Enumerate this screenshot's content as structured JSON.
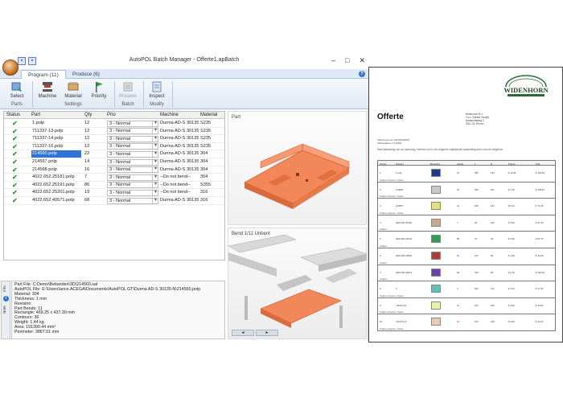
{
  "window": {
    "title": "AutoPOL Batch Manager - Offerte1.apBatch",
    "controls": [
      "–",
      "□",
      "✕"
    ]
  },
  "tabs": [
    {
      "label": "Program (11)",
      "active": true
    },
    {
      "label": "Produce (6)",
      "active": false
    }
  ],
  "ribbon": {
    "buttons": {
      "select": "Select",
      "machine": "Machine",
      "material": "Material",
      "priority": "Priority",
      "process": "Process",
      "inspect": "Inspect"
    },
    "groups": {
      "parts": "Parts",
      "settings": "Settings",
      "batch": "Batch",
      "modify": "Modify"
    }
  },
  "grid": {
    "columns": {
      "status": "Status",
      "part": "Part",
      "qty": "Qty",
      "prio": "Prio",
      "machine": "Machine",
      "material": "Material"
    },
    "rows": [
      {
        "part": "1.polp",
        "qty": "12",
        "prio": "3 - Normal",
        "machine": "Durma AD-S 30135...",
        "material": "S235"
      },
      {
        "part": "711337-13.polp",
        "qty": "12",
        "prio": "3 - Normal",
        "machine": "Durma AD-S 30135...",
        "material": "S235"
      },
      {
        "part": "711337-14.polp",
        "qty": "12",
        "prio": "3 - Normal",
        "machine": "Durma AD-S 30135...",
        "material": "S235"
      },
      {
        "part": "711337-16.polp",
        "qty": "12",
        "prio": "3 - Normal",
        "machine": "Durma AD-S 30135...",
        "material": "S235"
      },
      {
        "part": "214560.polp",
        "qty": "22",
        "prio": "3 - Normal",
        "machine": "Durma AD-S 30135...",
        "material": "304",
        "selected": true
      },
      {
        "part": "214567.polp",
        "qty": "14",
        "prio": "3 - Normal",
        "machine": "Durma AD-S 30135...",
        "material": "304"
      },
      {
        "part": "214568.polp",
        "qty": "16",
        "prio": "3 - Normal",
        "machine": "Durma AD-S 30135...",
        "material": "304"
      },
      {
        "part": "4022.652.25181.polp",
        "qty": "7",
        "prio": "3 - Normal",
        "machine": "--Do not bend--",
        "material": "304"
      },
      {
        "part": "4022.652.25191.polp",
        "qty": "86",
        "prio": "3 - Normal",
        "machine": "--Do not bend--",
        "material": "S355"
      },
      {
        "part": "4022.652.25201.polp",
        "qty": "19",
        "prio": "3 - Normal",
        "machine": "--Do not bend--",
        "material": "316"
      },
      {
        "part": "4022.652.40571.polp",
        "qty": "68",
        "prio": "3 - Normal",
        "machine": "Durma AD-S 30135...",
        "material": "316"
      }
    ]
  },
  "info": {
    "lines": [
      "Part File: C:Demo\\Beitanden\\3D\\214560.sat",
      "AutoPOL File: E:\\Users\\ance.ACEGA\\Documents\\AutoPOL GT\\Durma AD-S 30135-N\\214560.polp",
      "Material: 304",
      "Thickness: 1 mm",
      "Revision:",
      "Part Bends: 11",
      "Rectangle: 469.25 x 437.39 mm",
      "Contours: 36",
      "Weight: 1.44 kg",
      "Area: 191390.44 mm²",
      "Perimeter: 3867.01 mm"
    ]
  },
  "sidetabs": [
    "Info",
    "Note"
  ],
  "views": {
    "part_label": "Part",
    "bend_label": "Bend 1/11 Unbent",
    "nav": [
      "◄",
      "►"
    ]
  },
  "document": {
    "logo_text": "WIDENHORN",
    "title": "Offerte",
    "address": [
      "Widenhorn B.V.",
      "T.a.v. Gerard Hooijer",
      "Ambachtsweg 3",
      "3161 GL Rhoon"
    ],
    "meta": [
      "Offertenummer     OFF20230510",
      "Offertedatum      7-6-2023"
    ],
    "intro": "Naar aanleiding van uw aanvraag, hiermee kunt u de volgende vrijblijvende aanbieding doen van het volgende:",
    "columns": [
      "Positie",
      "Product",
      "Afbeelding",
      "Aantal",
      "L",
      "B",
      "Prijs/st.",
      "Prijs"
    ],
    "rows": [
      {
        "pos": "1",
        "product": "1.polp",
        "qty": "12",
        "l": "380",
        "b": "234",
        "unit": "€ 12,80",
        "total": "€ 153,60",
        "sub": "Snijden+Kanten / Zetten",
        "color": "#1f3c8c"
      },
      {
        "pos": "2",
        "product": "214560",
        "qty": "22",
        "l": "469",
        "b": "437",
        "unit": "€ 7,20",
        "total": "€ 158,40",
        "sub": "Snijden+Kanten / Zetten",
        "color": "#c9c9c9"
      },
      {
        "pos": "3",
        "product": "214567",
        "qty": "14",
        "l": "180",
        "b": "120",
        "unit": "€ 5,10",
        "total": "€ 71,40",
        "sub": "Snijden+Kanten / Zetten",
        "color": "#e6e07a"
      },
      {
        "pos": "4",
        "product": "4022.652.25181",
        "qty": "7",
        "l": "95",
        "b": "215",
        "unit": "€ 3,90",
        "total": "€ 27,30",
        "sub": "Snijden",
        "color": "#c8a98a"
      },
      {
        "pos": "5",
        "product": "4022.652.25191",
        "qty": "86",
        "l": "70",
        "b": "45",
        "unit": "€ 0,95",
        "total": "€ 81,70",
        "sub": "Snijden",
        "color": "#2f9e4f"
      },
      {
        "pos": "6",
        "product": "4022.652.25201",
        "qty": "19",
        "l": "110",
        "b": "60",
        "unit": "€ 1,60",
        "total": "€ 30,40",
        "sub": "Snijden",
        "color": "#b33a3a"
      },
      {
        "pos": "7",
        "product": "4022.652.40571",
        "qty": "68",
        "l": "150",
        "b": "90",
        "unit": "€ 2,75",
        "total": "€ 187,00",
        "sub": "Snijden",
        "color": "#6a3fb0"
      },
      {
        "pos": "8",
        "product": "2",
        "qty": "4",
        "l": "200",
        "b": "114",
        "unit": "€ 4,40",
        "total": "€ 17,60",
        "sub": "Snijden+Kanten / Zetten",
        "color": "#5fc2b8"
      },
      {
        "pos": "9",
        "product": "711337-13",
        "qty": "12",
        "l": "104",
        "b": "168",
        "unit": "€ 3,60",
        "total": "€ 43,20",
        "sub": "Snijden+Kanten / Zetten",
        "color": "#e9f3a4"
      },
      {
        "pos": "10",
        "product": "711337-14",
        "qty": "12",
        "l": "100",
        "b": "168",
        "unit": "€ 3,60",
        "total": "€ 43,20",
        "sub": "Snijden+Kanten / Zetten",
        "color": "#e8c9b5"
      }
    ]
  }
}
